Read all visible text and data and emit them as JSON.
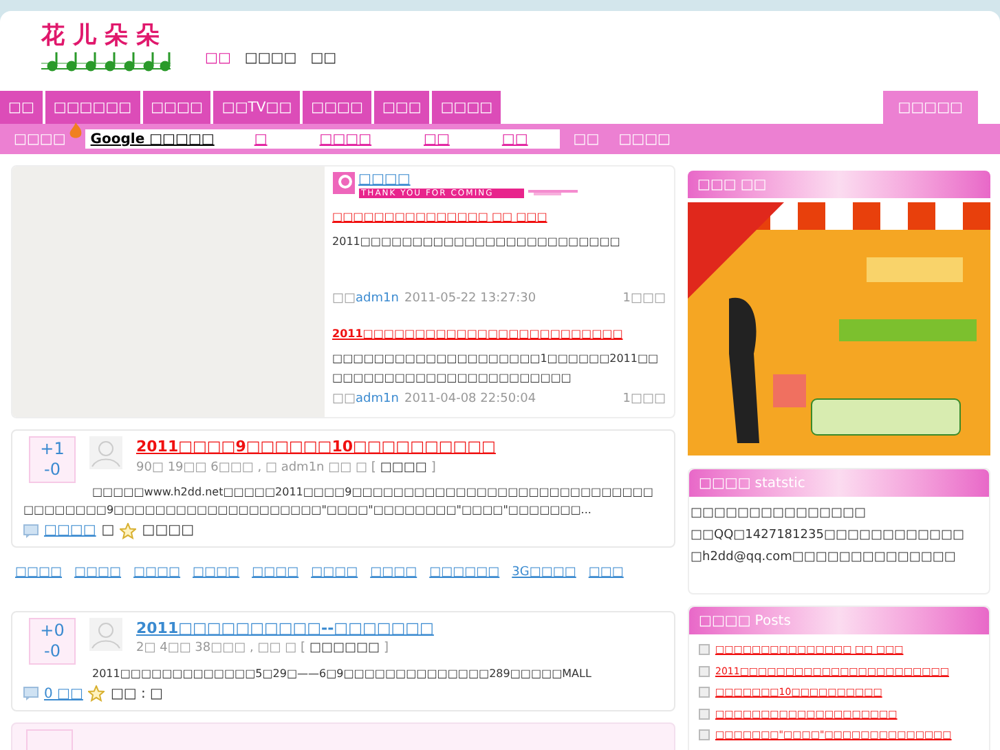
{
  "logo": {
    "title": "花儿朵朵"
  },
  "header_links": [
    {
      "label": "□□",
      "selected": true
    },
    {
      "label": "□□□□",
      "selected": false
    },
    {
      "label": "□□",
      "selected": false
    }
  ],
  "nav": [
    {
      "label": "□□",
      "selected": false
    },
    {
      "label": "□□□□□□",
      "selected": false
    },
    {
      "label": "□□□□",
      "selected": false
    },
    {
      "label": "□□TV□□",
      "selected": false
    },
    {
      "label": "□□□□",
      "selected": false
    },
    {
      "label": "□□□",
      "selected": false
    },
    {
      "label": "□□□□",
      "selected": false
    }
  ],
  "nav_right": {
    "label": "□□□□□",
    "selected": true
  },
  "subbar": {
    "label": "□□□□",
    "search_label": "Google □□□□□",
    "search_links": [
      "□",
      "□□□□",
      "□□",
      "□□"
    ],
    "links": [
      "□□",
      "□□□□"
    ]
  },
  "featured": {
    "heading": "□□□□",
    "banner": "THANK YOU FOR COMING",
    "posts": [
      {
        "title": "□□□□□□□□□□□□□□□ □□ □□□",
        "bold": false,
        "excerpt": "2011□□□□□□□□□□□□□□□□□□□□□□□□□",
        "by": "□□",
        "author": "adm1n",
        "date": "2011-05-22 13:27:30",
        "comments": "1□□□"
      },
      {
        "title": "2011□□□□□□□□□□□□□□□□□□□□□□□□□",
        "bold": true,
        "excerpt": "□□□□□□□□□□□□□□□□□□□□1□□□□□□2011□□□□□□□□□□□□□□□□□□□□□□□□□",
        "by": "□□",
        "author": "adm1n",
        "date": "2011-04-08 22:50:04",
        "comments": "1□□□"
      }
    ]
  },
  "articles": [
    {
      "up": "+1",
      "down": "-0",
      "title": "2011□□□□9□□□□□□10□□□□□□□□□□",
      "hot": true,
      "meta": "90□ 19□□ 6□□□ , □ adm1n □□ □ [",
      "category": "□□□□",
      "meta_end": "]",
      "body": "□□□□□www.h2dd.net□□□□□2011□□□□9□□□□□□□□□□□□□□□□□□□□□□□□□□□□□□□□□□□□□9□□□□□□□□□□□□□□□□□□□□\"□□□□\"□□□□□□□□\"□□□□\"□□□□□□□...",
      "comments": "□□□□",
      "sep": "□",
      "fav": "□□□□"
    },
    {
      "up": "+0",
      "down": "-0",
      "title": "2011□□□□□□□□□□--□□□□□□□",
      "hot": false,
      "meta": "2□ 4□□ 38□□□ , □□ □ [",
      "category": "□□□□□□",
      "meta_end": "]",
      "body": "2011□□□□□□□□□□□□□5□29□——6□9□□□□□□□□□□□□□□289□□□□□MALL",
      "comments": "0 □□",
      "fav": "□□ : □"
    }
  ],
  "tags": [
    "□□□□",
    "□□□□",
    "□□□□",
    "□□□□",
    "□□□□",
    "□□□□",
    "□□□□",
    "□□□□□□",
    "3G□□□□",
    "□□□"
  ],
  "sidebar": {
    "ad": {
      "title": "□□□",
      "sub": "□□"
    },
    "stats": {
      "title": "□□□□",
      "sub": "statstic",
      "lines": [
        "□□□□□□□□□□□□□□□",
        "□□QQ□1427181235□□□□□□□□□□□□",
        "□h2dd@qq.com□□□□□□□□□□□□□□"
      ]
    },
    "posts": {
      "title": "□□□□",
      "sub": "Posts",
      "items": [
        "□□□□□□□□□□□□□□□ □□ □□□",
        "2011□□□□□□□□□□□□□□□□□□□□□□□",
        "□□□□□□□10□□□□□□□□□□",
        "□□□□□□□□□□□□□□□□□□□□",
        "□□□□□□□\"□□□□\"□□□□□□□□□□□□□□"
      ]
    }
  }
}
